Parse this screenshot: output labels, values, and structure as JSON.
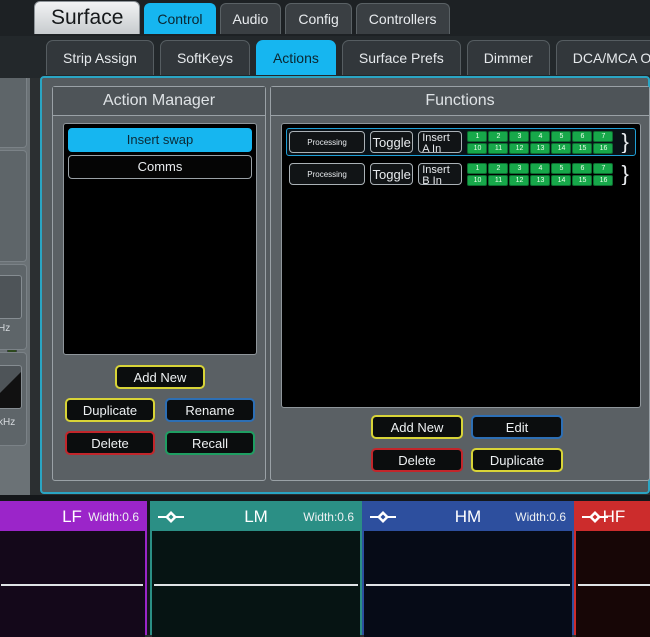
{
  "window": {
    "title": "Surface"
  },
  "top_tabs": [
    {
      "label": "Control",
      "active": true
    },
    {
      "label": "Audio",
      "active": false
    },
    {
      "label": "Config",
      "active": false
    },
    {
      "label": "Controllers",
      "active": false
    }
  ],
  "sub_tabs": [
    {
      "label": "Strip Assign",
      "active": false
    },
    {
      "label": "SoftKeys",
      "active": false
    },
    {
      "label": "Actions",
      "active": true
    },
    {
      "label": "Surface Prefs",
      "active": false
    },
    {
      "label": "Dimmer",
      "active": false
    },
    {
      "label": "DCA/MCA Option",
      "active": false
    }
  ],
  "action_manager": {
    "title": "Action Manager",
    "items": [
      {
        "label": "Insert swap",
        "selected": true
      },
      {
        "label": "Comms",
        "selected": false
      }
    ],
    "buttons": {
      "add_new": "Add New",
      "duplicate": "Duplicate",
      "rename": "Rename",
      "delete": "Delete",
      "recall": "Recall"
    }
  },
  "functions": {
    "title": "Functions",
    "rows": [
      {
        "category": "Processing",
        "mode": "Toggle",
        "target": "Insert A In",
        "selected": true,
        "grid_row_1": [
          "1",
          "2",
          "3",
          "4",
          "5",
          "6",
          "7"
        ],
        "grid_row_2": [
          "10",
          "11",
          "12",
          "13",
          "14",
          "15",
          "16"
        ],
        "overflow_glyph": "}"
      },
      {
        "category": "Processing",
        "mode": "Toggle",
        "target": "Insert B In",
        "selected": false,
        "grid_row_1": [
          "1",
          "2",
          "3",
          "4",
          "5",
          "6",
          "7"
        ],
        "grid_row_2": [
          "10",
          "11",
          "12",
          "13",
          "14",
          "15",
          "16"
        ],
        "overflow_glyph": "}"
      }
    ],
    "buttons": {
      "add_new": "Add New",
      "edit": "Edit",
      "delete": "Delete",
      "duplicate": "Duplicate"
    }
  },
  "eq_bands": [
    {
      "name": "LF",
      "width_label": "Width:0.6",
      "color": "#9b25c9",
      "fill": "#14081a",
      "show_marker": false
    },
    {
      "name": "LM",
      "width_label": "Width:0.6",
      "color": "#2b8f85",
      "fill": "#061413",
      "show_marker": true
    },
    {
      "name": "HM",
      "width_label": "Width:0.6",
      "color": "#2d4f9e",
      "fill": "#060b17",
      "show_marker": true
    },
    {
      "name": "HF",
      "width_label": "",
      "color": "#cc2c2c",
      "fill": "#170606",
      "show_marker": true
    }
  ],
  "left_strip": {
    "hz_label_1": "Hz",
    "hz_label_2": "kHz"
  },
  "colors": {
    "accent": "#16b6f0",
    "frame": "#2aa5c4",
    "grid_green": "#17a84a",
    "yellow": "#d8d437",
    "blue": "#2d6fb5",
    "red": "#c2262b",
    "green": "#1f9e62"
  }
}
